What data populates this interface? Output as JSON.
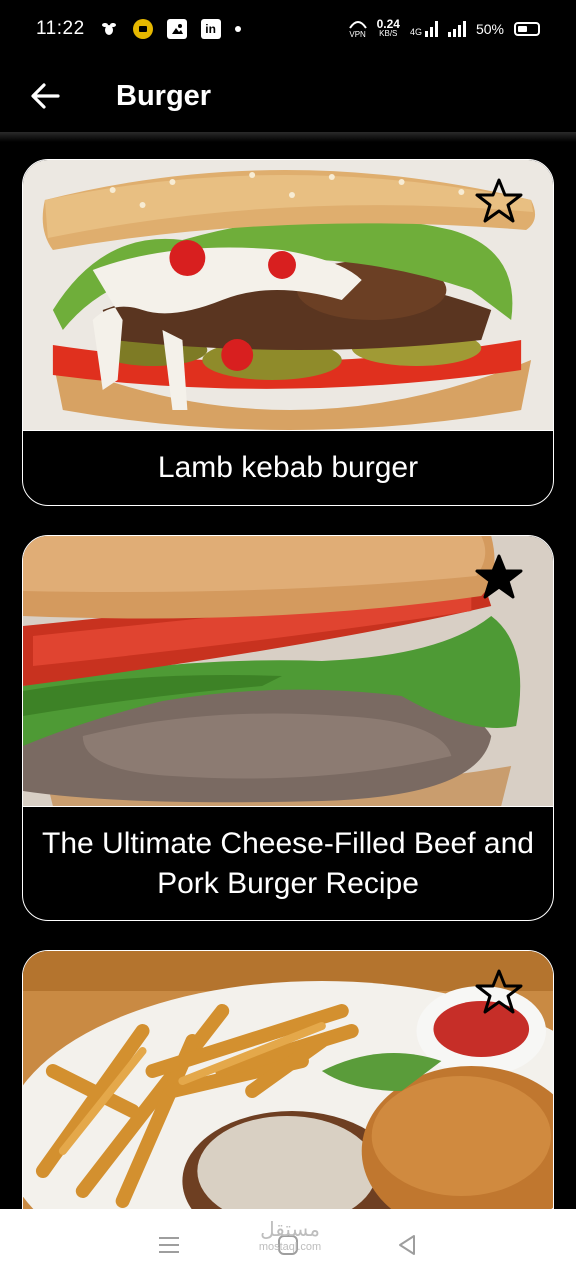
{
  "status_bar": {
    "time": "11:22",
    "notification_icons": [
      "bee-icon",
      "record-icon",
      "image-icon",
      "linkedin-icon"
    ],
    "linkedin_label": "in",
    "vpn_label": "VPN",
    "network_speed": "0.24",
    "network_speed_unit": "KB/S",
    "network_type": "4G",
    "battery_percent": "50%"
  },
  "app_bar": {
    "title": "Burger",
    "back_icon": "arrow-left-icon"
  },
  "recipes": [
    {
      "title": "Lamb kebab burger",
      "favorite": false
    },
    {
      "title": "The Ultimate Cheese-Filled Beef and Pork Burger Recipe",
      "favorite": true
    },
    {
      "title": "",
      "favorite": false
    }
  ],
  "nav_bar": {
    "items": [
      "menu-icon",
      "home-icon",
      "back-triangle-icon"
    ]
  },
  "watermark": {
    "line1": "مستقل",
    "line2": "mostaql.com"
  },
  "colors": {
    "background": "#000000",
    "text": "#ffffff",
    "nav_background": "#ffffff",
    "nav_icon": "#9e9e9e"
  }
}
